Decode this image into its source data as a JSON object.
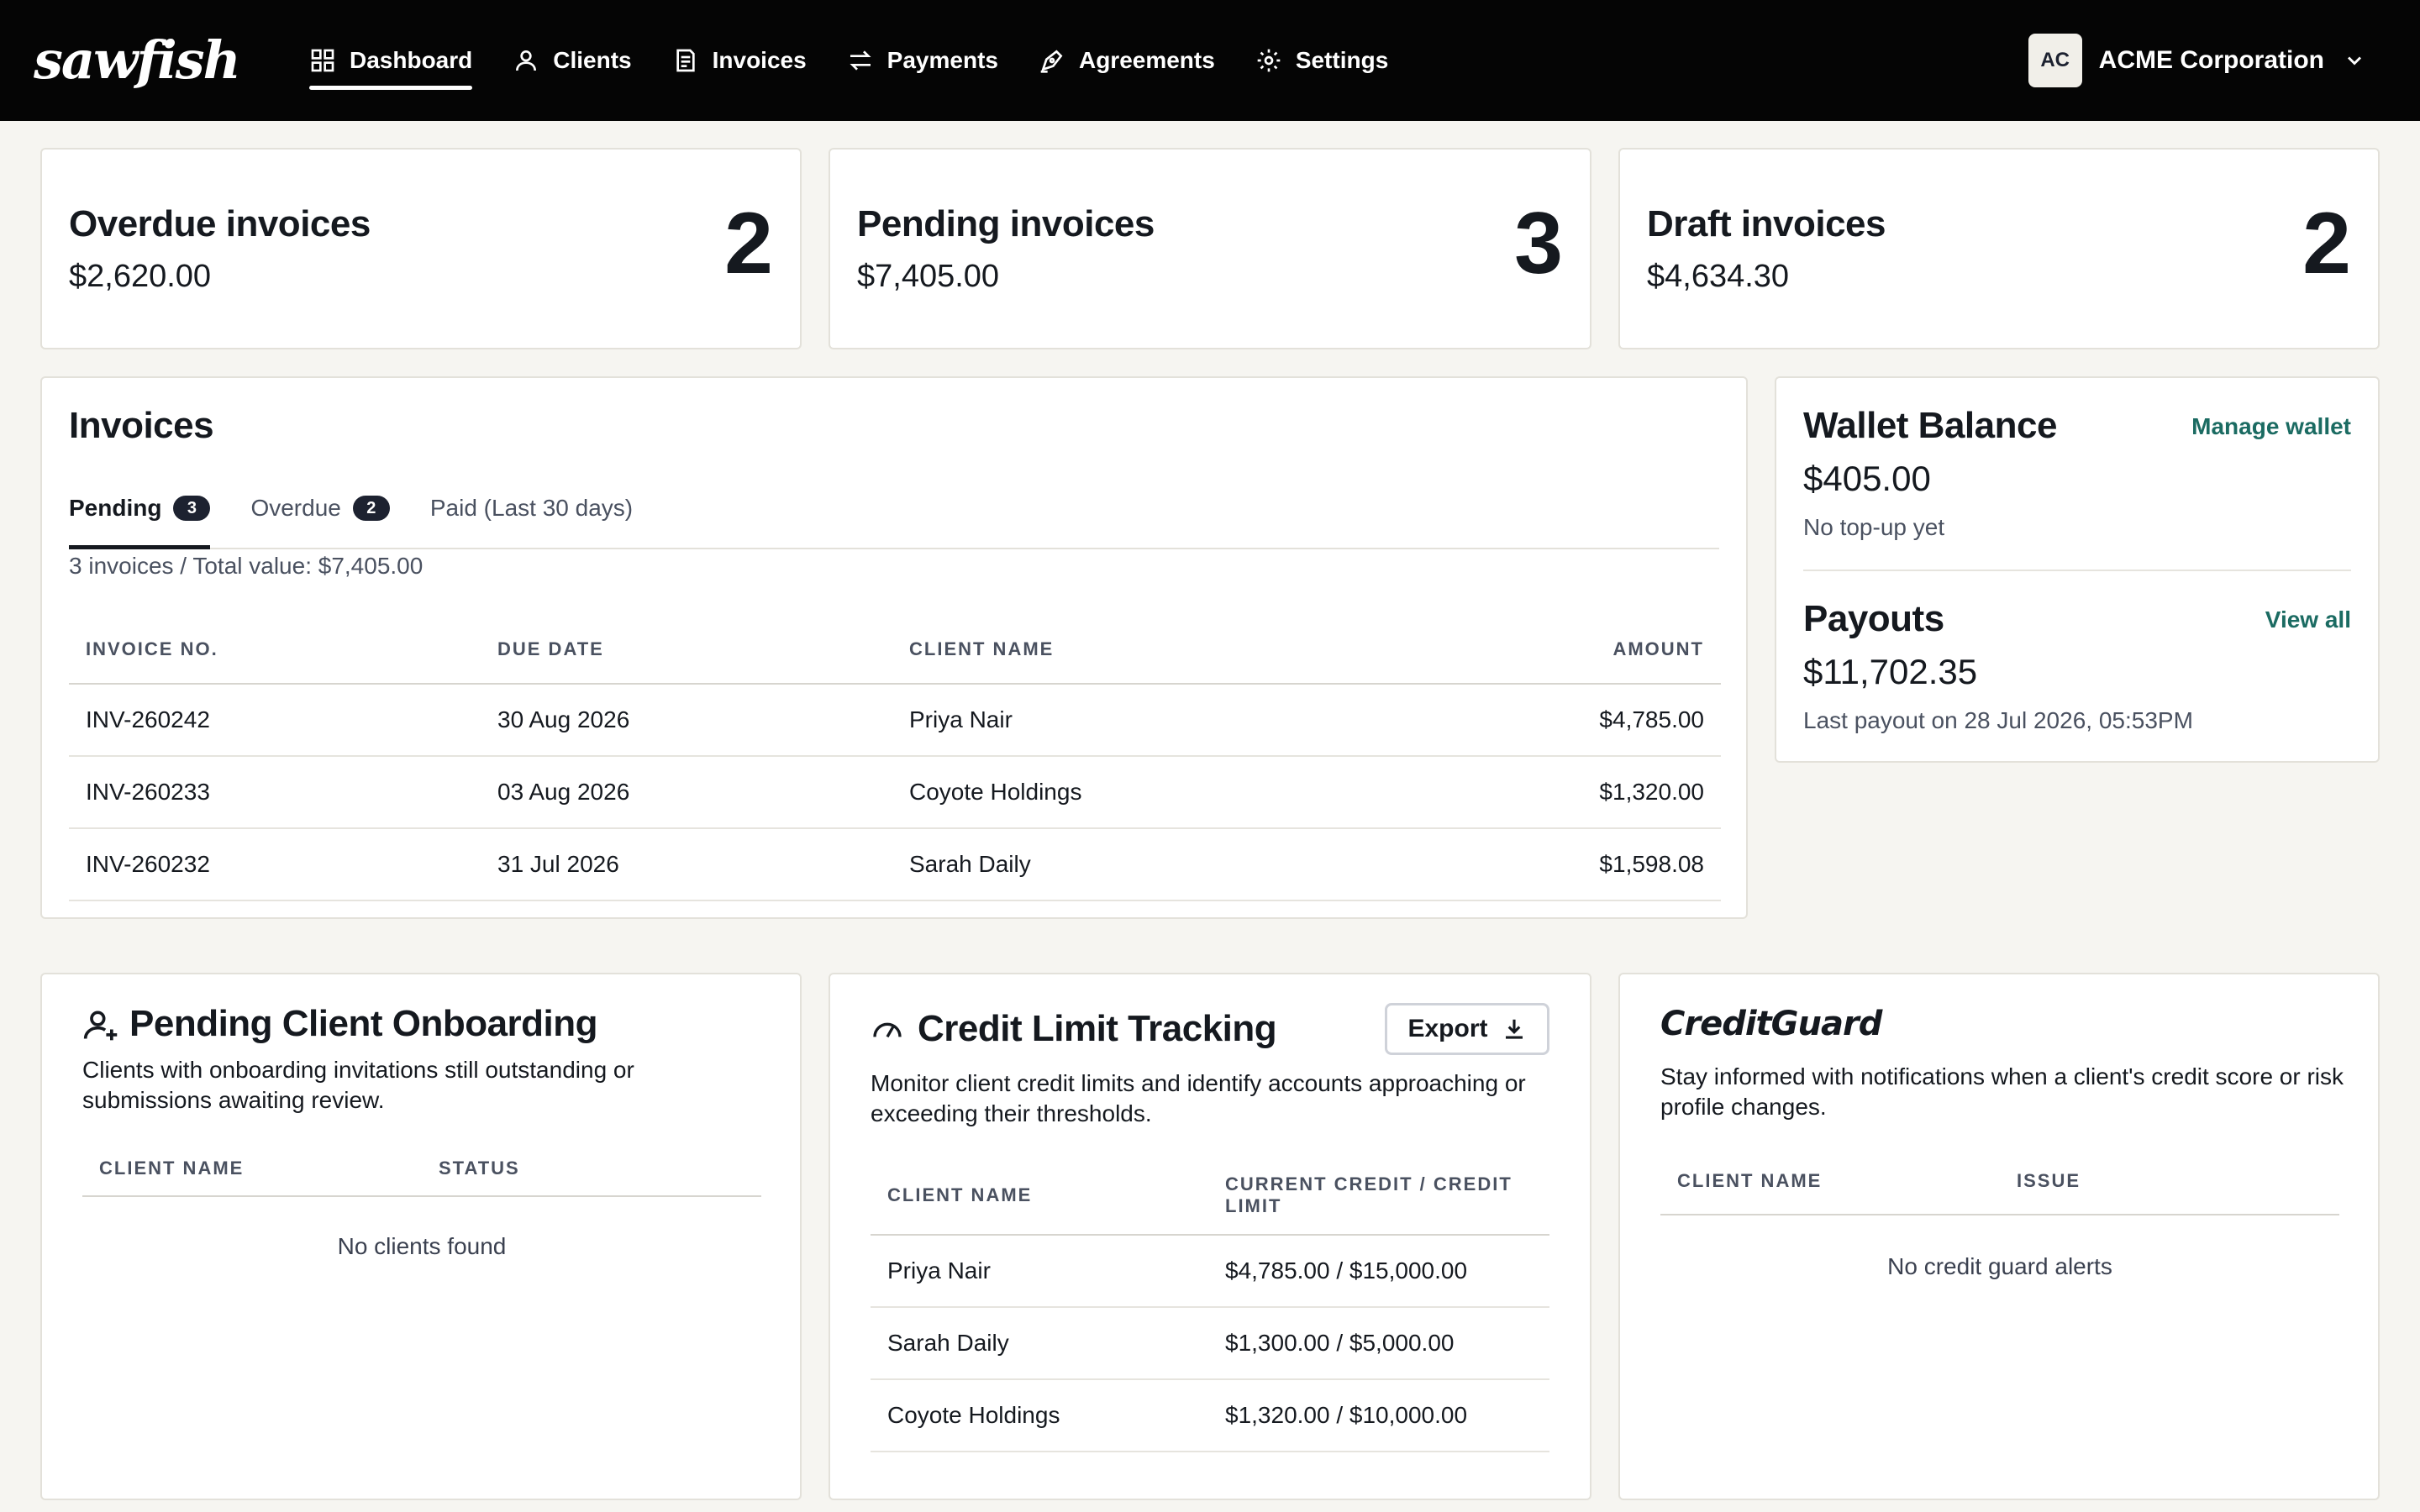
{
  "app": {
    "logo_text": "sawfish"
  },
  "nav": {
    "items": [
      {
        "label": "Dashboard",
        "icon": "dashboard-icon",
        "active": true
      },
      {
        "label": "Clients",
        "icon": "user-icon"
      },
      {
        "label": "Invoices",
        "icon": "invoice-icon"
      },
      {
        "label": "Payments",
        "icon": "transfer-icon"
      },
      {
        "label": "Agreements",
        "icon": "signature-icon"
      },
      {
        "label": "Settings",
        "icon": "gear-icon"
      }
    ]
  },
  "account": {
    "initials": "AC",
    "name": "ACME Corporation"
  },
  "stats": [
    {
      "title": "Overdue invoices",
      "amount": "$2,620.00",
      "count": "2"
    },
    {
      "title": "Pending invoices",
      "amount": "$7,405.00",
      "count": "3"
    },
    {
      "title": "Draft invoices",
      "amount": "$4,634.30",
      "count": "2"
    }
  ],
  "invoices": {
    "title": "Invoices",
    "tabs": [
      {
        "label": "Pending",
        "count": "3",
        "active": true
      },
      {
        "label": "Overdue",
        "count": "2"
      },
      {
        "label": "Paid (Last 30 days)"
      }
    ],
    "summary": "3 invoices / Total value: $7,405.00",
    "columns": [
      "INVOICE NO.",
      "DUE DATE",
      "CLIENT NAME",
      "AMOUNT"
    ],
    "rows": [
      [
        "INV-260242",
        "30 Aug 2026",
        "Priya Nair",
        "$4,785.00"
      ],
      [
        "INV-260233",
        "03 Aug 2026",
        "Coyote Holdings",
        "$1,320.00"
      ],
      [
        "INV-260232",
        "31 Jul 2026",
        "Sarah Daily",
        "$1,598.08"
      ]
    ]
  },
  "wallet": {
    "title": "Wallet Balance",
    "link": "Manage wallet",
    "balance": "$405.00",
    "note": "No top-up yet"
  },
  "payouts": {
    "title": "Payouts",
    "link": "View all",
    "amount": "$11,702.35",
    "note": "Last payout on 28 Jul 2026, 05:53PM"
  },
  "onboarding": {
    "title": "Pending Client Onboarding",
    "icon": "user-plus-icon",
    "description": "Clients with onboarding invitations still outstanding or submissions awaiting review.",
    "columns": [
      "CLIENT NAME",
      "STATUS"
    ],
    "empty": "No clients found"
  },
  "credit": {
    "title": "Credit Limit Tracking",
    "icon": "gauge-icon",
    "export_label": "Export",
    "description": "Monitor client credit limits and identify accounts approaching or exceeding their thresholds.",
    "columns": [
      "CLIENT NAME",
      "CURRENT CREDIT / CREDIT LIMIT"
    ],
    "rows": [
      [
        "Priya Nair",
        "$4,785.00 / $15,000.00"
      ],
      [
        "Sarah Daily",
        "$1,300.00 / $5,000.00"
      ],
      [
        "Coyote Holdings",
        "$1,320.00 / $10,000.00"
      ]
    ]
  },
  "creditguard": {
    "logo_text": "CreditGuard",
    "description": "Stay informed with notifications when a client's credit score or risk profile changes.",
    "columns": [
      "CLIENT NAME",
      "ISSUE"
    ],
    "empty": "No credit guard alerts"
  }
}
